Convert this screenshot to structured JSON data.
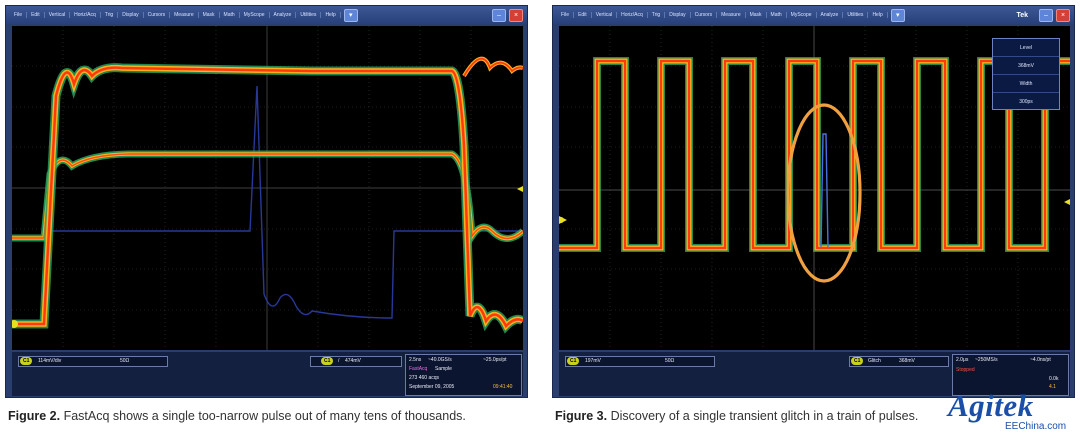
{
  "left_window": {
    "menu": [
      "File",
      "Edit",
      "Vertical",
      "Horiz/Acq",
      "Trig",
      "Display",
      "Cursors",
      "Measure",
      "Mask",
      "Math",
      "MyScope",
      "Analyze",
      "Utilities",
      "Help"
    ],
    "readout": {
      "ch1_scale": "114mV/div",
      "ch1_term": "50Ω",
      "trig_level": "474mV",
      "timebase": "2.5ns",
      "sample_rate": "~40.0GS/s",
      "record": "~25.0ps/pt",
      "mode_fastacq": "FastAcq",
      "mode_sample": "Sample",
      "acqs": "273 460 acqs",
      "date": "September 09, 2005",
      "time": "09:41:40"
    }
  },
  "right_window": {
    "title": "Tek",
    "menu": [
      "File",
      "Edit",
      "Vertical",
      "Horiz/Acq",
      "Trig",
      "Display",
      "Cursors",
      "Measure",
      "Mask",
      "Math",
      "MyScope",
      "Analyze",
      "Utilities",
      "Help"
    ],
    "popup": {
      "level_label": "Level",
      "level_value": "368mV",
      "width_label": "Width",
      "width_value": "300ps"
    },
    "readout": {
      "ch1_scale": "197mV",
      "ch1_term": "50Ω",
      "trig_info": "Glitch",
      "trig_level": "368mV",
      "timebase": "2.0μs",
      "sample_rate": "~250MS/s",
      "record": "~4.0ns/pt",
      "status": "Stopped",
      "count": "0.0k",
      "acq": "4.1"
    }
  },
  "captions": {
    "fig2_label": "Figure 2.",
    "fig2_text": " FastAcq shows a single too-narrow pulse out of many tens of thousands.",
    "fig3_label": "Figure 3.",
    "fig3_text": " Discovery of a single transient glitch in a train of pulses."
  },
  "watermark": {
    "brand": "Agitek",
    "site": "EEChina.com"
  },
  "colors": {
    "trace_hot": "#ff4a12",
    "trace_warm": "#ffb020",
    "trace_cool": "#28a860",
    "glitch": "#2c3ea8",
    "highlight": "#f0a040",
    "chip": "#c9d020"
  }
}
